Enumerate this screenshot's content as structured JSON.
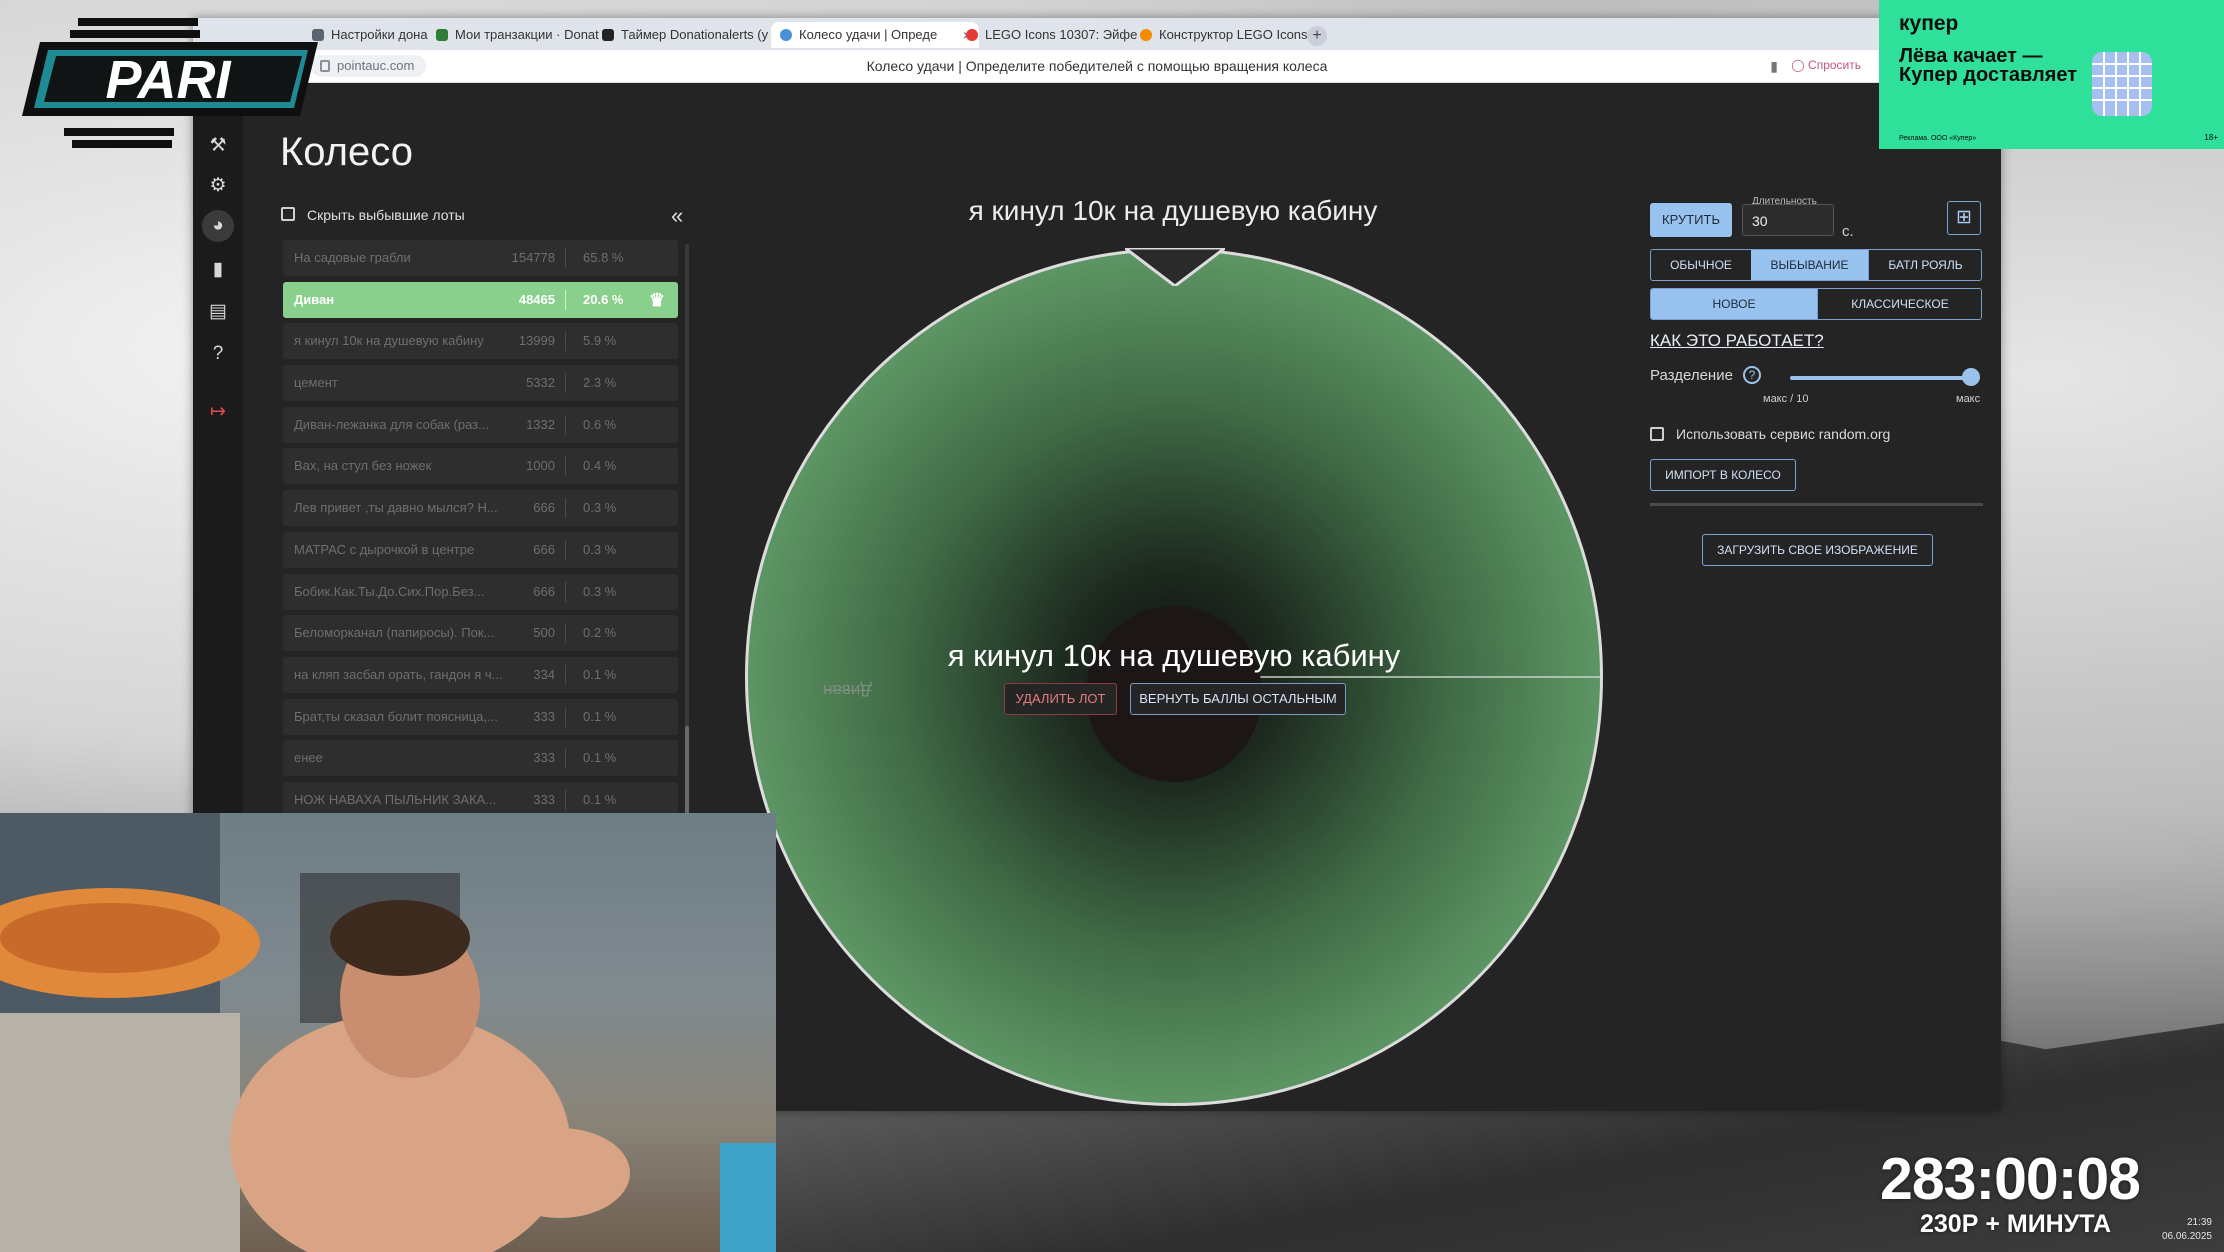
{
  "browser": {
    "tabs": [
      {
        "label": "Настройки дона"
      },
      {
        "label": "Мои транзакции · Donat"
      },
      {
        "label": "Таймер Donationalerts (у"
      },
      {
        "label": "Колесо удачи | Опреде"
      },
      {
        "label": "LEGO Icons 10307: Эйфе"
      },
      {
        "label": "Конструктор LEGO Icons"
      }
    ],
    "new_tab": "+",
    "url": "pointauc.com",
    "page_title": "Колесо удачи | Определите победителей с помощью вращения колеса",
    "ask_label": "Спросить"
  },
  "app": {
    "heading": "Колесо",
    "hide_dropped_label": "Скрыть выбывшие лоты",
    "collapse_label": "«",
    "lots": [
      {
        "name": "На садовые грабли",
        "amount": "154778",
        "percent": "65.8 %",
        "dropped": true
      },
      {
        "name": "Диван",
        "amount": "48465",
        "percent": "20.6 %",
        "dropped": false
      },
      {
        "name": "я кинул 10к на душевую кабину",
        "amount": "13999",
        "percent": "5.9 %",
        "dropped": true
      },
      {
        "name": "цемент",
        "amount": "5332",
        "percent": "2.3 %",
        "dropped": true
      },
      {
        "name": "Диван-лежанка для собак (раз...",
        "amount": "1332",
        "percent": "0.6 %",
        "dropped": true
      },
      {
        "name": "Вах, на стул без ножек",
        "amount": "1000",
        "percent": "0.4 %",
        "dropped": true
      },
      {
        "name": "Лев привет ,ты давно мылся? Н...",
        "amount": "666",
        "percent": "0.3 %",
        "dropped": true
      },
      {
        "name": "МАТРАС с дырочкой в центре",
        "amount": "666",
        "percent": "0.3 %",
        "dropped": true
      },
      {
        "name": "Бобик.Как.Ты.До.Сих.Пор.Без...",
        "amount": "666",
        "percent": "0.3 %",
        "dropped": true
      },
      {
        "name": "Беломорканал (папиросы). Пок...",
        "amount": "500",
        "percent": "0.2 %",
        "dropped": true
      },
      {
        "name": "на кляп засбал орать, гандон я ч...",
        "amount": "334",
        "percent": "0.1 %",
        "dropped": true
      },
      {
        "name": "Брат,ты сказал болит поясница,...",
        "amount": "333",
        "percent": "0.1 %",
        "dropped": true
      },
      {
        "name": "енее",
        "amount": "333",
        "percent": "0.1 %",
        "dropped": true
      },
      {
        "name": "НОЖ НАВАХА ПЫЛЬНИК ЗАКА...",
        "amount": "333",
        "percent": "0.1 %",
        "dropped": true
      }
    ],
    "wheel": {
      "title": "я кинул 10к на душевую кабину",
      "segment_label": "Диван",
      "winner_text": "я кинул 10к на душевую кабину",
      "delete_lot_label": "УДАЛИТЬ ЛОТ",
      "return_points_label": "ВЕРНУТЬ БАЛЛЫ ОСТАЛЬНЫМ"
    },
    "controls": {
      "spin_label": "КРУТИТЬ",
      "duration_label": "Длительность",
      "duration_value": "30",
      "duration_unit": "с.",
      "modes": [
        {
          "label": "ОБЫЧНОЕ",
          "selected": false
        },
        {
          "label": "ВЫБЫВАНИЕ",
          "selected": true
        },
        {
          "label": "БАТЛ РОЯЛЬ",
          "selected": false
        }
      ],
      "types": [
        {
          "label": "НОВОЕ",
          "selected": true
        },
        {
          "label": "КЛАССИЧЕСКОЕ",
          "selected": false
        }
      ],
      "how_link": "КАК ЭТО РАБОТАЕТ?",
      "split_label": "Разделение",
      "split_help": "?",
      "split_min_label": "макс / 10",
      "split_max_label": "макс",
      "split_value": 1.0,
      "random_org_label": "Использовать сервис random.org",
      "import_label": "ИМПОРТ В КОЛЕСО",
      "upload_label": "ЗАГРУЗИТЬ СВОЕ ИЗОБРАЖЕНИЕ"
    }
  },
  "overlay": {
    "logo_text": "PARI",
    "ad": {
      "brand": "купер",
      "text": "Лёва качает — Купер доставляет",
      "fine_print": "Реклама. ООО «Купер»",
      "corner": "18+"
    },
    "timer": "283:00:08",
    "price_line": "230Р + МИНУТА",
    "clock_time": "21:39",
    "clock_date": "06.06.2025"
  },
  "colors": {
    "accent": "#99c3ef",
    "winner_row": "#8ad08d",
    "wheel_green": "#5d9463",
    "danger": "#e77c7c",
    "ad_green": "#2fe09a"
  }
}
